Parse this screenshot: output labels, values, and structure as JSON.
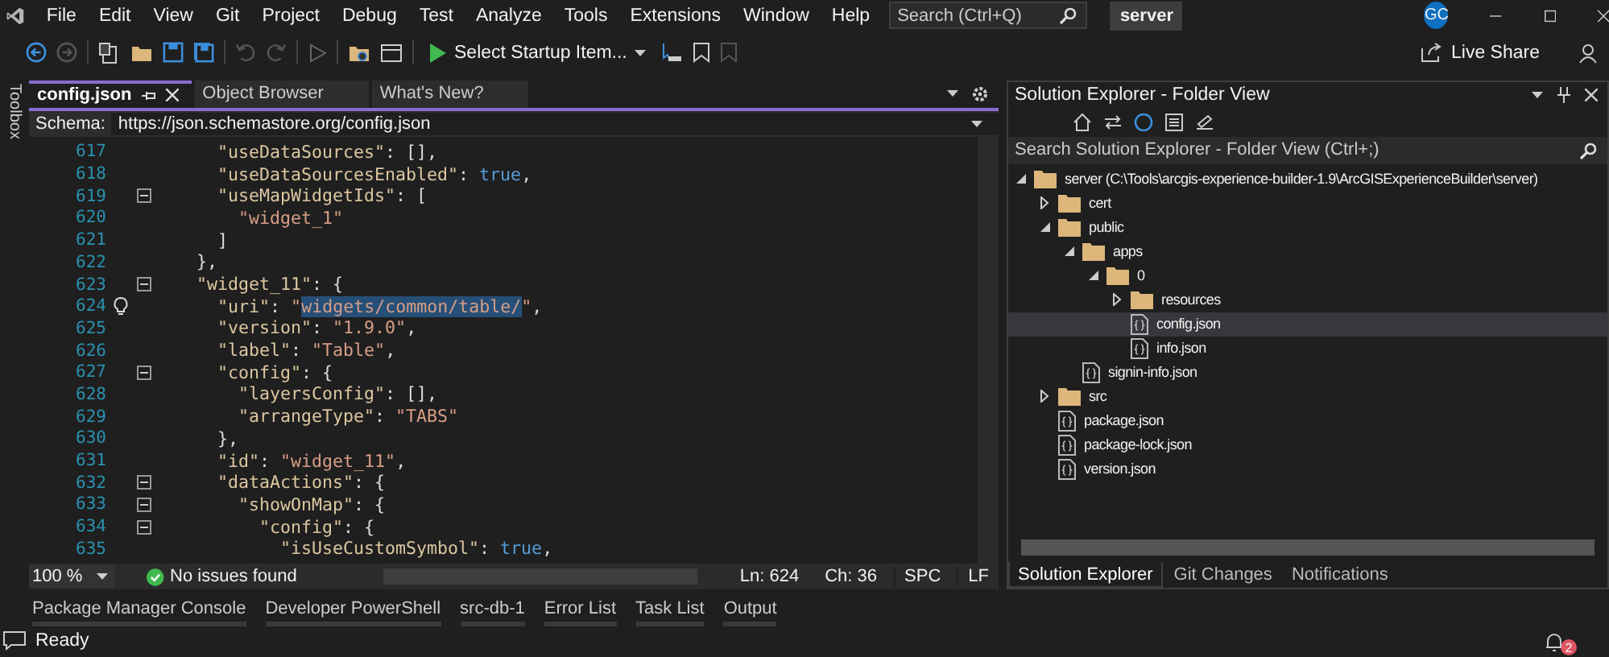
{
  "menu_bar": {
    "items": [
      "File",
      "Edit",
      "View",
      "Git",
      "Project",
      "Debug",
      "Test",
      "Analyze",
      "Tools",
      "Extensions",
      "Window",
      "Help"
    ],
    "search": {
      "placeholder": "Search (Ctrl+Q)"
    },
    "solution_name": "server",
    "avatar": "GC"
  },
  "toolbar": {
    "startup": "Select Startup Item...",
    "live_share": "Live Share"
  },
  "toolbox": {
    "label": "Toolbox"
  },
  "editor": {
    "tabs": [
      {
        "label": "config.json",
        "selected": true
      },
      {
        "label": "Object Browser",
        "selected": false
      },
      {
        "label": "What's New?",
        "selected": false
      }
    ],
    "schema": {
      "label": "Schema:",
      "value": "https://json.schemastore.org/config.json"
    },
    "lines": [
      {
        "number": "617",
        "collapsible": false,
        "lightbulb": false,
        "tokens": [
          {
            "kind": "key",
            "text": "      \"useDataSources\""
          },
          {
            "kind": "punct",
            "text": ": [],"
          }
        ]
      },
      {
        "number": "618",
        "collapsible": false,
        "lightbulb": false,
        "tokens": [
          {
            "kind": "key",
            "text": "      \"useDataSourcesEnabled\""
          },
          {
            "kind": "punct",
            "text": ": "
          },
          {
            "kind": "bool",
            "text": "true"
          },
          {
            "kind": "punct",
            "text": ","
          }
        ]
      },
      {
        "number": "619",
        "collapsible": true,
        "lightbulb": false,
        "tokens": [
          {
            "kind": "key",
            "text": "      \"useMapWidgetIds\""
          },
          {
            "kind": "punct",
            "text": ": ["
          }
        ]
      },
      {
        "number": "620",
        "collapsible": false,
        "lightbulb": false,
        "tokens": [
          {
            "kind": "string",
            "text": "        \"widget_1\""
          }
        ]
      },
      {
        "number": "621",
        "collapsible": false,
        "lightbulb": false,
        "tokens": [
          {
            "kind": "punct",
            "text": "      ]"
          }
        ]
      },
      {
        "number": "622",
        "collapsible": false,
        "lightbulb": false,
        "tokens": [
          {
            "kind": "punct",
            "text": "    },"
          }
        ]
      },
      {
        "number": "623",
        "collapsible": true,
        "lightbulb": false,
        "tokens": [
          {
            "kind": "key",
            "text": "    \"widget_11\""
          },
          {
            "kind": "punct",
            "text": ": {"
          }
        ]
      },
      {
        "number": "624",
        "collapsible": false,
        "lightbulb": true,
        "tokens": [
          {
            "kind": "key",
            "text": "      \"uri\""
          },
          {
            "kind": "punct",
            "text": ": "
          },
          {
            "kind": "string",
            "text": "\""
          },
          {
            "kind": "selection",
            "text": "widgets/common/table/"
          },
          {
            "kind": "string",
            "text": "\""
          },
          {
            "kind": "punct",
            "text": ","
          }
        ]
      },
      {
        "number": "625",
        "collapsible": false,
        "lightbulb": false,
        "tokens": [
          {
            "kind": "key",
            "text": "      \"version\""
          },
          {
            "kind": "punct",
            "text": ": "
          },
          {
            "kind": "string",
            "text": "\"1.9.0\""
          },
          {
            "kind": "punct",
            "text": ","
          }
        ]
      },
      {
        "number": "626",
        "collapsible": false,
        "lightbulb": false,
        "tokens": [
          {
            "kind": "key",
            "text": "      \"label\""
          },
          {
            "kind": "punct",
            "text": ": "
          },
          {
            "kind": "string",
            "text": "\"Table\""
          },
          {
            "kind": "punct",
            "text": ","
          }
        ]
      },
      {
        "number": "627",
        "collapsible": true,
        "lightbulb": false,
        "tokens": [
          {
            "kind": "key",
            "text": "      \"config\""
          },
          {
            "kind": "punct",
            "text": ": {"
          }
        ]
      },
      {
        "number": "628",
        "collapsible": false,
        "lightbulb": false,
        "tokens": [
          {
            "kind": "key",
            "text": "        \"layersConfig\""
          },
          {
            "kind": "punct",
            "text": ": [],"
          }
        ]
      },
      {
        "number": "629",
        "collapsible": false,
        "lightbulb": false,
        "tokens": [
          {
            "kind": "key",
            "text": "        \"arrangeType\""
          },
          {
            "kind": "punct",
            "text": ": "
          },
          {
            "kind": "string",
            "text": "\"TABS\""
          }
        ]
      },
      {
        "number": "630",
        "collapsible": false,
        "lightbulb": false,
        "tokens": [
          {
            "kind": "punct",
            "text": "      },"
          }
        ]
      },
      {
        "number": "631",
        "collapsible": false,
        "lightbulb": false,
        "tokens": [
          {
            "kind": "key",
            "text": "      \"id\""
          },
          {
            "kind": "punct",
            "text": ": "
          },
          {
            "kind": "string",
            "text": "\"widget_11\""
          },
          {
            "kind": "punct",
            "text": ","
          }
        ]
      },
      {
        "number": "632",
        "collapsible": true,
        "lightbulb": false,
        "tokens": [
          {
            "kind": "key",
            "text": "      \"dataActions\""
          },
          {
            "kind": "punct",
            "text": ": {"
          }
        ]
      },
      {
        "number": "633",
        "collapsible": true,
        "lightbulb": false,
        "tokens": [
          {
            "kind": "key",
            "text": "        \"showOnMap\""
          },
          {
            "kind": "punct",
            "text": ": {"
          }
        ]
      },
      {
        "number": "634",
        "collapsible": true,
        "lightbulb": false,
        "tokens": [
          {
            "kind": "key",
            "text": "          \"config\""
          },
          {
            "kind": "punct",
            "text": ": {"
          }
        ]
      },
      {
        "number": "635",
        "collapsible": false,
        "lightbulb": false,
        "tokens": [
          {
            "kind": "key",
            "text": "            \"isUseCustomSymbol\""
          },
          {
            "kind": "punct",
            "text": ": "
          },
          {
            "kind": "bool",
            "text": "true"
          },
          {
            "kind": "punct",
            "text": ","
          }
        ]
      }
    ],
    "status": {
      "zoom": "100 %",
      "issues": "No issues found",
      "line": "Ln: 624",
      "column": "Ch: 36",
      "indent": "SPC",
      "line_ending": "LF"
    }
  },
  "solution_explorer": {
    "title": "Solution Explorer - Folder View",
    "search": {
      "placeholder": "Search Solution Explorer - Folder View (Ctrl+;)"
    },
    "tree": [
      {
        "kind": "folder",
        "label": "server (C:\\Tools\\arcgis-experience-builder-1.9\\ArcGISExperienceBuilder\\server)",
        "expanded": true,
        "selected": false,
        "children": [
          {
            "kind": "folder",
            "label": "cert",
            "expanded": false,
            "selected": false
          },
          {
            "kind": "folder",
            "label": "public",
            "expanded": true,
            "selected": false,
            "children": [
              {
                "kind": "folder",
                "label": "apps",
                "expanded": true,
                "selected": false,
                "children": [
                  {
                    "kind": "folder",
                    "label": "0",
                    "expanded": true,
                    "selected": false,
                    "children": [
                      {
                        "kind": "folder",
                        "label": "resources",
                        "expanded": false,
                        "selected": false
                      },
                      {
                        "kind": "file",
                        "label": "config.json",
                        "selected": true
                      },
                      {
                        "kind": "file",
                        "label": "info.json",
                        "selected": false
                      }
                    ]
                  }
                ]
              },
              {
                "kind": "file",
                "label": "signin-info.json",
                "selected": false
              }
            ]
          },
          {
            "kind": "folder",
            "label": "src",
            "expanded": false,
            "selected": false
          },
          {
            "kind": "file",
            "label": "package.json",
            "selected": false
          },
          {
            "kind": "file",
            "label": "package-lock.json",
            "selected": false
          },
          {
            "kind": "file",
            "label": "version.json",
            "selected": false
          }
        ]
      }
    ],
    "tabs": [
      {
        "label": "Solution Explorer",
        "selected": true
      },
      {
        "label": "Git Changes",
        "selected": false
      },
      {
        "label": "Notifications",
        "selected": false
      }
    ]
  },
  "tool_tabs": [
    "Package Manager Console",
    "Developer PowerShell",
    "src-db-1",
    "Error List",
    "Task List",
    "Output"
  ],
  "status_bar": {
    "text": "Ready",
    "notifications": "2"
  }
}
